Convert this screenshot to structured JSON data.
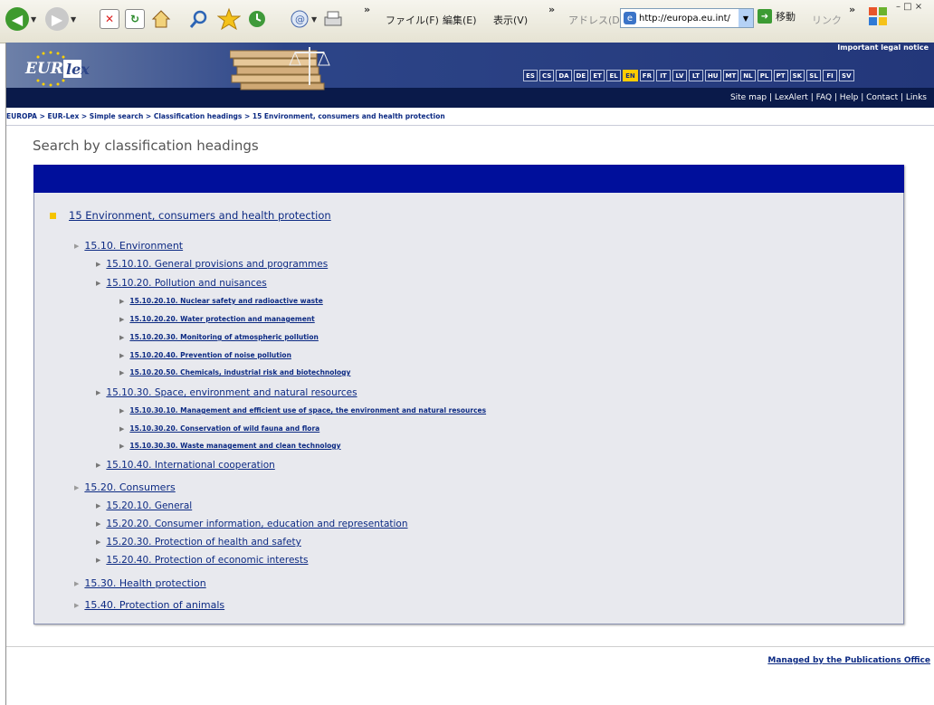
{
  "browser": {
    "menus": [
      "ファイル(F)",
      "編集(E)",
      "表示(V)"
    ],
    "address_label": "アドレス(D)",
    "address_url": "http://europa.eu.int/",
    "go_label": "移動",
    "links_label": "リンク",
    "win_controls": "–  □  ×"
  },
  "banner": {
    "legal_notice": "Important legal notice",
    "logo_text": "EUR-Lex",
    "languages": [
      "ES",
      "CS",
      "DA",
      "DE",
      "ET",
      "EL",
      "EN",
      "FR",
      "IT",
      "LV",
      "LT",
      "HU",
      "MT",
      "NL",
      "PL",
      "PT",
      "SK",
      "SL",
      "FI",
      "SV"
    ],
    "active_language": "EN",
    "top_links": [
      "Site map",
      "LexAlert",
      "FAQ",
      "Help",
      "Contact",
      "Links"
    ]
  },
  "breadcrumb": "EUROPA > EUR-Lex > Simple search > Classification headings > 15 Environment, consumers and health protection",
  "page_title": "Search by classification headings",
  "tree": {
    "root": "15 Environment, consumers and health protection",
    "items": [
      {
        "label": "15.10. Environment"
      },
      {
        "label": "15.10.10. General provisions and programmes"
      },
      {
        "label": "15.10.20. Pollution and nuisances"
      },
      {
        "label": "15.10.20.10. Nuclear safety and radioactive waste"
      },
      {
        "label": "15.10.20.20. Water protection and management"
      },
      {
        "label": "15.10.20.30. Monitoring of atmospheric pollution"
      },
      {
        "label": "15.10.20.40. Prevention of noise pollution"
      },
      {
        "label": "15.10.20.50. Chemicals, industrial risk and biotechnology"
      },
      {
        "label": "15.10.30. Space, environment and natural resources"
      },
      {
        "label": "15.10.30.10. Management and efficient use of space, the environment and natural resources"
      },
      {
        "label": "15.10.30.20. Conservation of wild fauna and flora"
      },
      {
        "label": "15.10.30.30. Waste management and clean technology"
      },
      {
        "label": "15.10.40. International cooperation"
      },
      {
        "label": "15.20. Consumers"
      },
      {
        "label": "15.20.10. General"
      },
      {
        "label": "15.20.20. Consumer information, education and representation"
      },
      {
        "label": "15.20.30. Protection of health and safety"
      },
      {
        "label": "15.20.40. Protection of economic interests"
      },
      {
        "label": "15.30. Health protection"
      },
      {
        "label": "15.40. Protection of animals"
      }
    ]
  },
  "footer_link": "Managed by the Publications Office",
  "colors": {
    "panel_header": "#000f9b",
    "link": "#0c2a83",
    "active_lang": "#ffcc00"
  }
}
